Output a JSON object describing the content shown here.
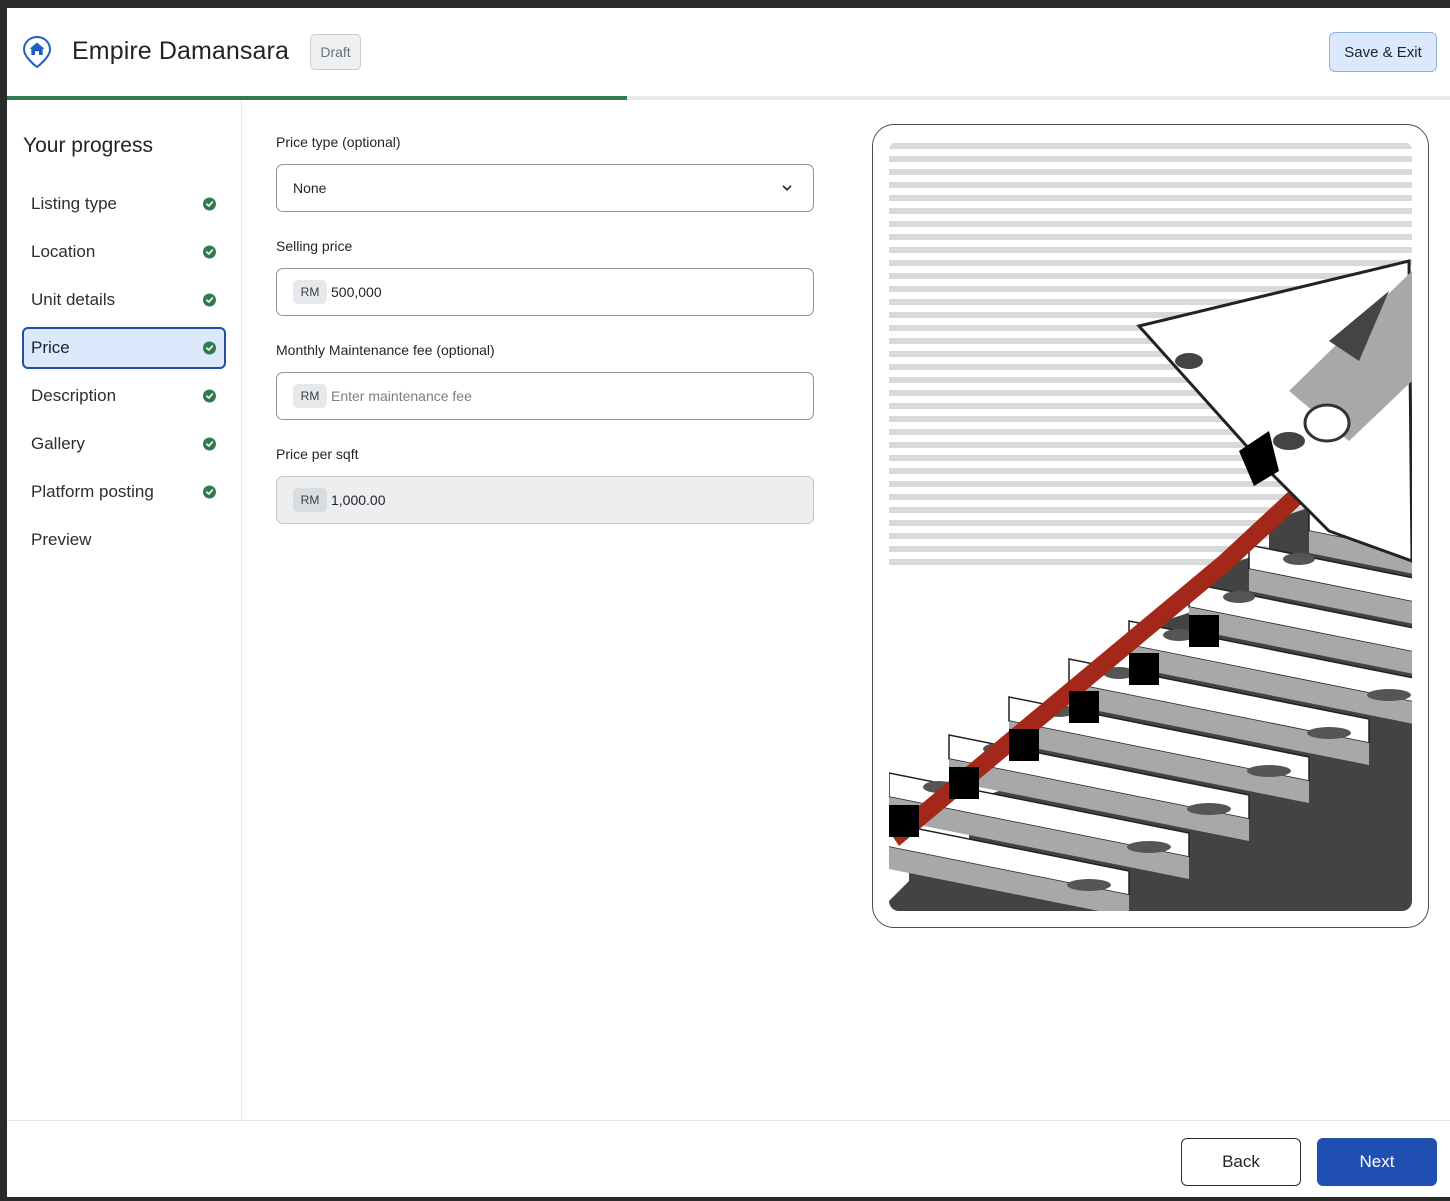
{
  "header": {
    "title": "Empire Damansara",
    "badge": "Draft",
    "save_exit_label": "Save & Exit"
  },
  "progress": {
    "fraction": 0.43
  },
  "sidebar": {
    "title": "Your progress",
    "items": [
      {
        "label": "Listing type",
        "completed": true,
        "active": false
      },
      {
        "label": "Location",
        "completed": true,
        "active": false
      },
      {
        "label": "Unit details",
        "completed": true,
        "active": false
      },
      {
        "label": "Price",
        "completed": true,
        "active": true
      },
      {
        "label": "Description",
        "completed": true,
        "active": false
      },
      {
        "label": "Gallery",
        "completed": true,
        "active": false
      },
      {
        "label": "Platform posting",
        "completed": true,
        "active": false
      },
      {
        "label": "Preview",
        "completed": false,
        "active": false
      }
    ]
  },
  "form": {
    "price_type": {
      "label": "Price type",
      "optional": "(optional)",
      "value": "None"
    },
    "selling_price": {
      "label": "Selling price",
      "prefix": "RM",
      "value": "500,000"
    },
    "maintenance_fee": {
      "label": "Monthly Maintenance fee",
      "optional": "(optional)",
      "prefix": "RM",
      "value": "",
      "placeholder": "Enter maintenance fee"
    },
    "price_per_sqft": {
      "label": "Price per sqft",
      "prefix": "RM",
      "value": "1,000.00"
    }
  },
  "footer": {
    "back_label": "Back",
    "next_label": "Next"
  },
  "colors": {
    "accent": "#1f4fb0",
    "accent_light": "#dce8fb",
    "success": "#2e7d4f",
    "illustration_red": "#a3281a"
  },
  "icons": {
    "logo": "house-pin-icon",
    "check": "check-circle-icon",
    "dropdown": "chevron-down-icon"
  }
}
